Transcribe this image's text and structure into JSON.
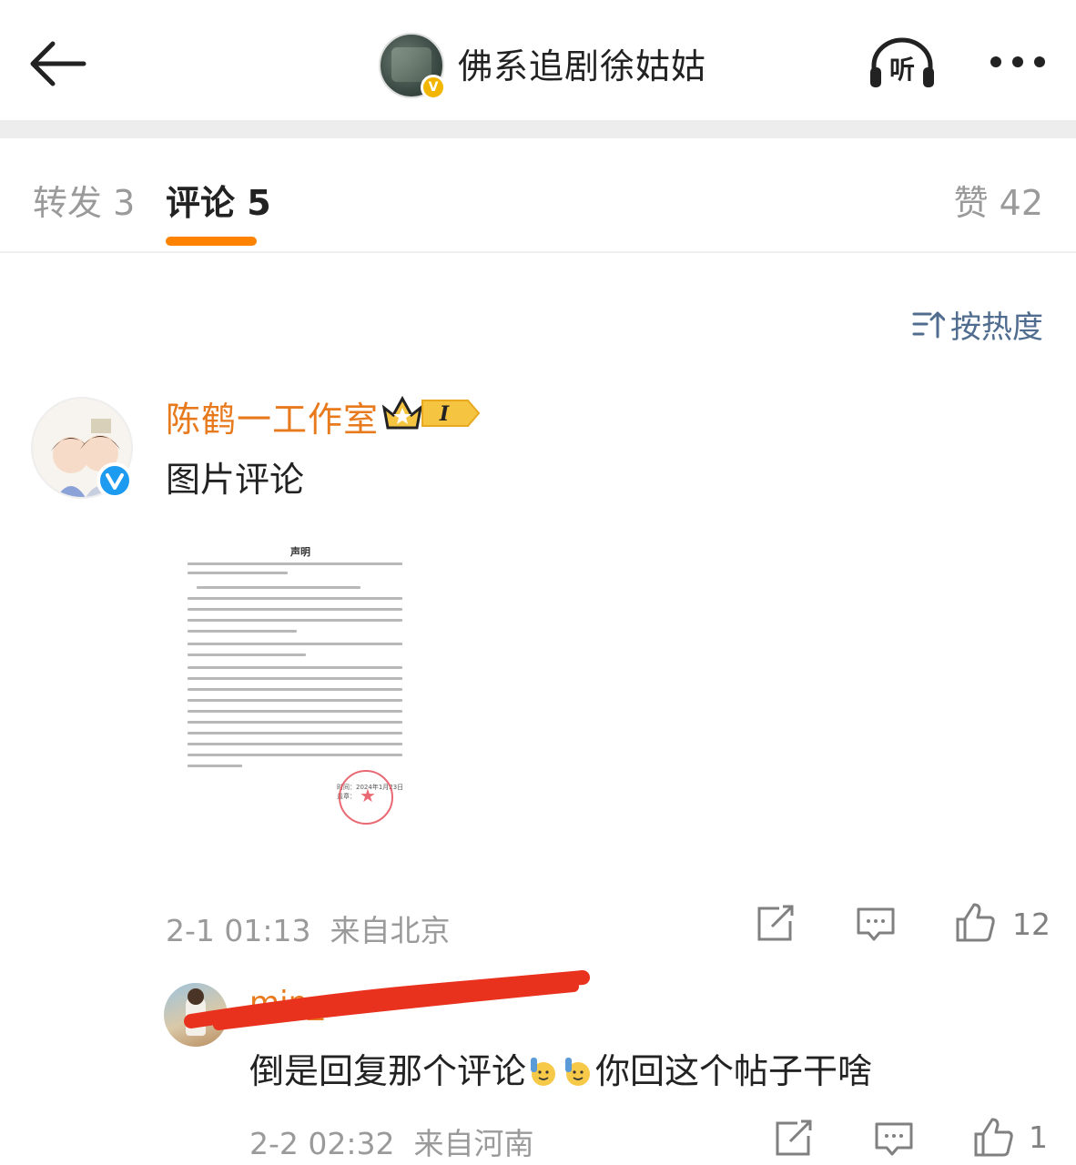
{
  "header": {
    "title": "佛系追剧徐姑姑",
    "listen_label": "听",
    "verified_badge": "V"
  },
  "tabs": [
    {
      "label": "转发 3"
    },
    {
      "label": "评论 5",
      "active": true
    },
    {
      "label": "赞 42"
    }
  ],
  "accent_color": "#ff8200",
  "sort": {
    "label": "按热度"
  },
  "comments": [
    {
      "author": "陈鹤一工作室",
      "level_badge": "I",
      "text": "图片评论",
      "time": "2-1 01:13",
      "location": "来自北京",
      "likes": "12",
      "attachment": {
        "title": "声明",
        "sig_line_1": "时间：2024年1月23日",
        "sig_line_2": "盖章："
      }
    },
    {
      "author": "min_",
      "text_part1": "倒是回复那个评论",
      "text_part2": "你回这个帖子干啥",
      "emoji": "raising-hand-emoji",
      "time": "2-2 02:32",
      "location": "来自河南",
      "likes": "1"
    }
  ]
}
